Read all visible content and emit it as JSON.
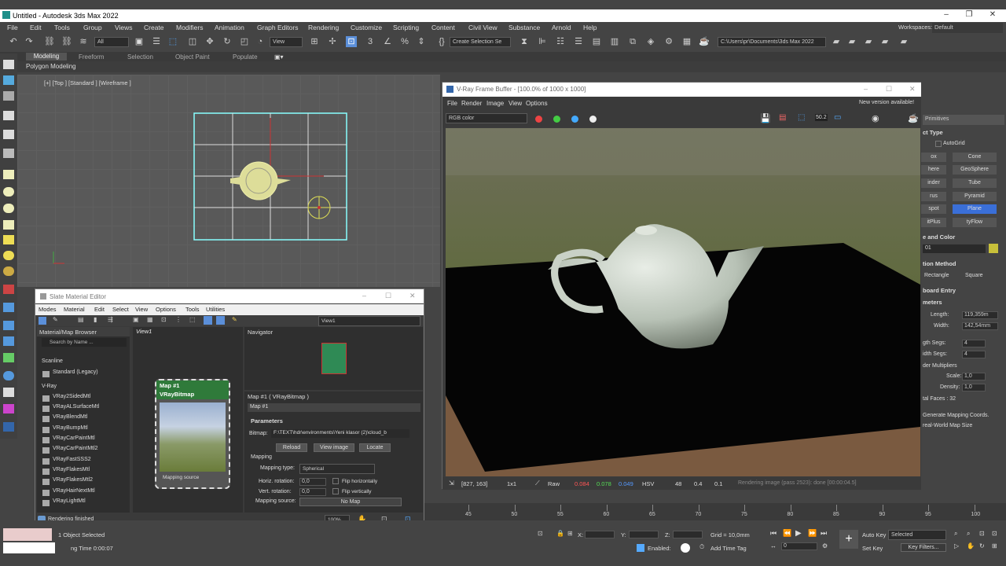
{
  "window": {
    "title": "Untitled - Autodesk 3ds Max 2022",
    "workspaces_label": "Workspaces:",
    "workspace": "Default"
  },
  "menu": [
    "File",
    "Edit",
    "Tools",
    "Group",
    "Views",
    "Create",
    "Modifiers",
    "Animation",
    "Graph Editors",
    "Rendering",
    "Customize",
    "Scripting",
    "Content",
    "Civil View",
    "Substance",
    "Arnold",
    "Help"
  ],
  "toolbar": {
    "filter": "All",
    "view": "View",
    "selection_set": "Create Selection Se",
    "project_path": "C:\\Users\\pr\\Documents\\3ds Max 2022"
  },
  "ribbon": {
    "tabs": [
      "Modeling",
      "Freeform",
      "Selection",
      "Object Paint",
      "Populate"
    ],
    "sub": "Polygon Modeling"
  },
  "viewport": {
    "label": "[+] [Top ] [Standard ] [Wireframe ]"
  },
  "vfb": {
    "title": "V-Ray Frame Buffer - [100.0% of 1000 x 1000]",
    "menu": [
      "File",
      "Render",
      "Image",
      "View",
      "Options"
    ],
    "new_version": "New version available!",
    "channel": "RGB color",
    "zoom_label": "50.2",
    "status": {
      "coords": "[827, 163]",
      "ratio": "1x1",
      "mode": "Raw",
      "r": "0.084",
      "g": "0.078",
      "b": "0.049",
      "space": "HSV",
      "h": "48",
      "s": "0.4",
      "v": "0.1",
      "message": "Rendering image (pass 2523): done [00:00:04.5]"
    }
  },
  "sme": {
    "title": "Slate Material Editor",
    "menu": [
      "Modes",
      "Material",
      "Edit",
      "Select",
      "View",
      "Options",
      "Tools",
      "Utilities"
    ],
    "view_select": "View1",
    "browser_title": "Material/Map Browser",
    "search_placeholder": "Search by Name ...",
    "groups": {
      "scanline": "Scanline",
      "vray": "V-Ray"
    },
    "scanline_items": [
      "Standard (Legacy)"
    ],
    "vray_items": [
      "VRay2SidedMtl",
      "VRayALSurfaceMtl",
      "VRayBlendMtl",
      "VRayBumpMtl",
      "VRayCarPaintMtl",
      "VRayCarPaintMtl2",
      "VRayFastSSS2",
      "VRayFlakesMtl",
      "VRayFlakesMtl2",
      "VRayHairNextMtl",
      "VRayLightMtl"
    ],
    "view_tab": "View1",
    "node": {
      "title": "Map #1",
      "subtitle": "VRayBitmap",
      "footer": "Mapping source"
    },
    "navigator_title": "Navigator",
    "param_header": "Map #1  ( VRayBitmap )",
    "param_name": "Map #1",
    "parameters_label": "Parameters",
    "bitmap_label": "Bitmap:",
    "bitmap_path": "F:\\TEXT\\hdr\\environments\\Yeni klasor (2)\\cloud_b",
    "buttons": [
      "Reload",
      "View image",
      "Locate"
    ],
    "mapping_label": "Mapping",
    "mapping_type_label": "Mapping type:",
    "mapping_type": "Spherical",
    "horiz_rotation_label": "Horiz. rotation:",
    "horiz_rotation": "0,0",
    "vert_rotation_label": "Vert. rotation:",
    "vert_rotation": "0,0",
    "flip_h": "Flip horizontally",
    "flip_v": "Flip vertically",
    "mapping_source_label": "Mapping source:",
    "mapping_source": "No Map",
    "status": "Rendering finished",
    "zoom": "100%"
  },
  "cmd": {
    "dropdown": "Primitives",
    "object_type": "ct Type",
    "autogrid": "AutoGrid",
    "buttons_left": [
      "ox",
      "here",
      "inder",
      "rus",
      "spot",
      "itPlus"
    ],
    "buttons_right": [
      "Cone",
      "GeoSphere",
      "Tube",
      "Pyramid",
      "Plane",
      "tyFlow"
    ],
    "name_color": "e and Color",
    "name_value": "01",
    "creation_method": "tion Method",
    "rectangle": "Rectangle",
    "square": "Square",
    "keyboard_entry": "board Entry",
    "parameters": "meters",
    "length_label": "Length:",
    "length": "119,359m",
    "width_label": "Width:",
    "width": "142,54mm",
    "length_segs_label": "gth Segs:",
    "length_segs": "4",
    "width_segs_label": "idth Segs:",
    "width_segs": "4",
    "render_mult": "der Multipliers",
    "scale_label": "Scale:",
    "scale": "1,0",
    "density_label": "Density:",
    "density": "1,0",
    "total_faces": "tal Faces : 32",
    "gen_mapping": "Generate Mapping Coords.",
    "real_world": "real-World Map Size",
    "accent": "#3a6fd8"
  },
  "timeline": {
    "ticks": [
      "45",
      "50",
      "55",
      "60",
      "65",
      "70",
      "75",
      "80",
      "85",
      "90",
      "95",
      "100"
    ]
  },
  "status": {
    "selected": "1 Object Selected",
    "render_time": "ng Time  0:00:07",
    "x_label": "X:",
    "y_label": "Y:",
    "z_label": "Z:",
    "grid": "Grid = 10,0mm",
    "enabled": "Enabled:",
    "add_time_tag": "Add Time Tag",
    "auto_key": "Auto Key",
    "selected_dd": "Selected",
    "set_key": "Set Key",
    "key_filters": "Key Filters...",
    "frame": "0"
  }
}
